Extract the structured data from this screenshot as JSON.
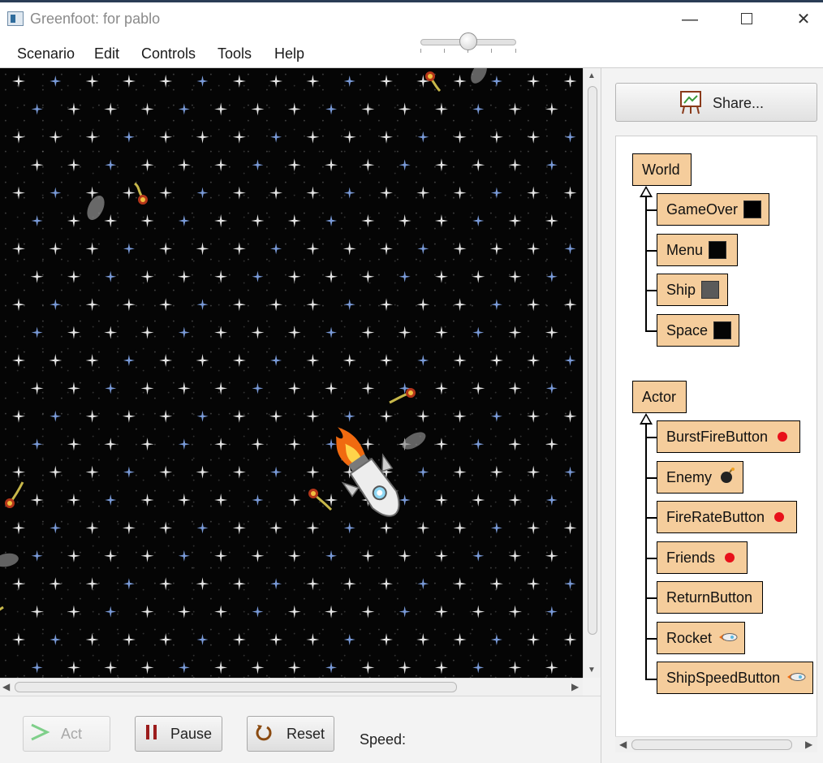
{
  "window": {
    "title": "Greenfoot: for pablo",
    "minimize_glyph": "—",
    "close_glyph": "✕"
  },
  "menu": {
    "items": [
      "Scenario",
      "Edit",
      "Controls",
      "Tools",
      "Help"
    ]
  },
  "controls": {
    "act_label": "Act",
    "act_enabled": false,
    "pause_label": "Pause",
    "reset_label": "Reset",
    "speed_label": "Speed:",
    "speed_value_fraction": 0.5
  },
  "share": {
    "label": "Share..."
  },
  "class_tree": {
    "world_root": "World",
    "world_subclasses": [
      "GameOver",
      "Menu",
      "Ship",
      "Space"
    ],
    "actor_root": "Actor",
    "actor_subclasses": [
      "BurstFireButton",
      "Enemy",
      "FireRateButton",
      "Friends",
      "ReturnButton",
      "Rocket",
      "ShipSpeedButton"
    ]
  },
  "colors": {
    "class_box": "#f5cd9c",
    "world_background": "#050505",
    "button_red_dot": "#e8101a",
    "act_arrow": "#7fcf8a",
    "pause_icon": "#9c1c1c",
    "reset_icon": "#8a4a10"
  },
  "icons": {
    "act": "play-arrow-icon",
    "pause": "pause-icon",
    "reset": "reset-icon",
    "share": "easel-icon"
  }
}
